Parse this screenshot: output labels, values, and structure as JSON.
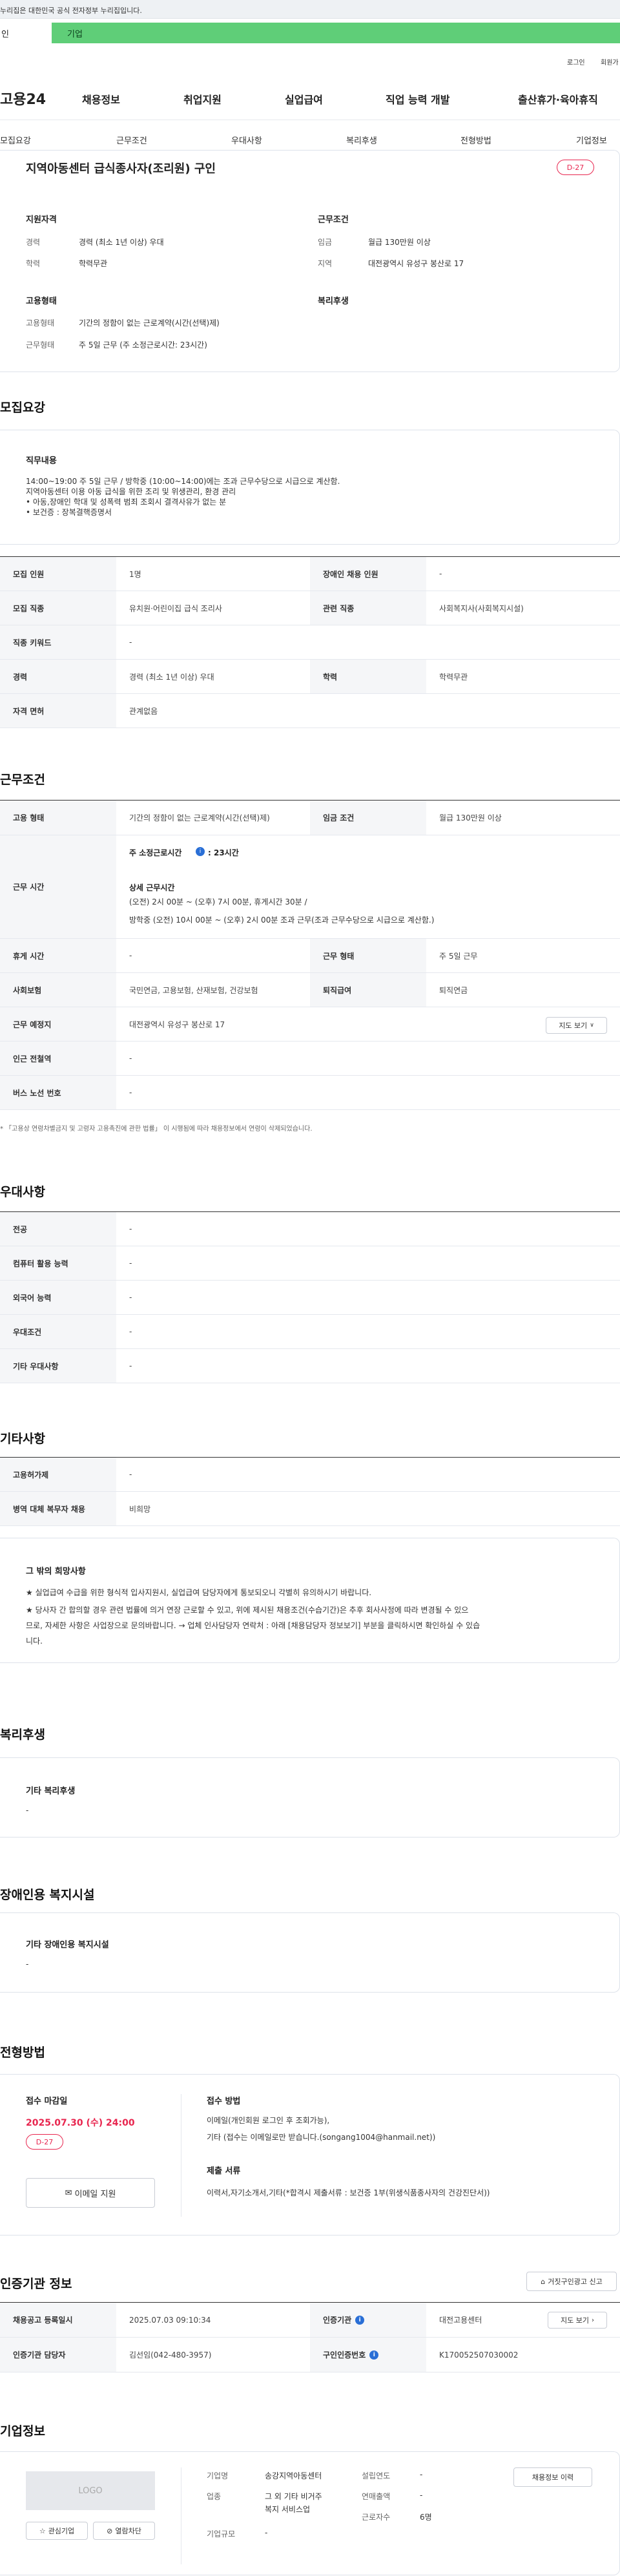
{
  "gov_banner": "누리집은 대한민국 공식 전자정부 누리집입니다.",
  "usertabs": {
    "person": "인",
    "company": "기업"
  },
  "util": {
    "login": "로그인",
    "join": "회원가"
  },
  "gnb": {
    "logo": "고용24",
    "items": [
      "채용정보",
      "취업지원",
      "실업급여",
      "직업 능력 개발",
      "출산휴가·육아휴직"
    ]
  },
  "tabs": [
    "모집요강",
    "근무조건",
    "우대사항",
    "복리후생",
    "전형방법",
    "기업정보"
  ],
  "summary": {
    "title": "지역아동센터 급식종사자(조리원) 구인",
    "dday": "D-27",
    "qual_head": "지원자격",
    "qual": [
      {
        "k": "경력",
        "v": "경력 (최소 1년 이상) 우대"
      },
      {
        "k": "학력",
        "v": "학력무관"
      }
    ],
    "cond_head": "근무조건",
    "cond": [
      {
        "k": "임금",
        "v": "월급 130만원 이상"
      },
      {
        "k": "지역",
        "v": "대전광역시 유성구 봉산로 17"
      }
    ],
    "emp_head": "고용형태",
    "emp": [
      {
        "k": "고용형태",
        "v": "기간의 정함이 없는 근로계약(시간(선택)제)"
      },
      {
        "k": "근무형태",
        "v": "주 5일 근무 (주 소정근로시간: 23시간)"
      }
    ],
    "welfare_head": "복리후생"
  },
  "recruit": {
    "title": "모집요강",
    "duty_head": "직무내용",
    "duty_lines": [
      "14:00~19:00 주 5일 근무 / 방학중 (10:00~14:00)에는 조과 근무수당으로 시급으로 계산함.",
      "지역아동센터 이용 아동 급식을 위한 조리 및 위생관리, 환경 관리",
      "• 아동,장애인 학대 및 성폭력 범죄 조회시 결격사유가 없는 분",
      "• 보건증 : 장복결핵증명서"
    ],
    "rows": [
      {
        "k1": "모집 인원",
        "v1": "1명",
        "k2": "장애인 채용 인원",
        "v2": "-"
      },
      {
        "k1": "모집 직종",
        "v1": "유치원·어린이집 급식 조리사",
        "k2": "관련 직종",
        "v2": "사회복지사(사회복지시설)"
      },
      {
        "k1": "직종 키워드",
        "v1": "-"
      },
      {
        "k1": "경력",
        "v1": "경력 (최소 1년 이상) 우대",
        "k2": "학력",
        "v2": "학력무관"
      },
      {
        "k1": "자격 면허",
        "v1": "관계없음"
      }
    ]
  },
  "work": {
    "title": "근무조건",
    "r1": {
      "k1": "고용 형태",
      "v1": "기간의 정함이 없는 근로계약(시간(선택)제)",
      "k2": "임금 조건",
      "v2": "월급 130만원 이상"
    },
    "hours": {
      "k": "근무 시간",
      "weekly_label": "주 소정근로시간",
      "weekly_value": ": 23시간",
      "detail_head": "상세 근무시간",
      "lines": [
        "(오전) 2시 00분 ~ (오후) 7시 00분, 휴게시간 30분 /",
        "방학중 (오전) 10시 00분 ~ (오후) 2시 00분 조과 근무(조과 근무수당으로 시급으로 계산함.)"
      ]
    },
    "r2": {
      "k1": "휴게 시간",
      "v1": "-",
      "k2": "근무 형태",
      "v2": "주 5일 근무"
    },
    "r3": {
      "k1": "사회보험",
      "v1": "국민연금, 고용보험, 산재보험, 건강보험",
      "k2": "퇴직급여",
      "v2": "퇴직연금"
    },
    "r4": {
      "k": "근무 예정지",
      "v": "대전광역시 유성구 봉산로 17",
      "btn": "지도 보기"
    },
    "r5": {
      "k": "인근 전철역",
      "v": "-"
    },
    "r6": {
      "k": "버스 노선 번호",
      "v": "-"
    },
    "note": "* 「고용상 연령차별금지 및 고령자 고용촉진에 관한 법률」 이 시행됨에 따라 채용정보에서 연령이 삭제되었습니다."
  },
  "pref": {
    "title": "우대사항",
    "rows": [
      {
        "k": "전공",
        "v": "-"
      },
      {
        "k": "컴퓨터 활용 능력",
        "v": "-"
      },
      {
        "k": "외국어 능력",
        "v": "-"
      },
      {
        "k": "우대조건",
        "v": "-"
      },
      {
        "k": "기타 우대사항",
        "v": "-"
      }
    ]
  },
  "etc": {
    "title": "기타사항",
    "rows": [
      {
        "k": "고용허가제",
        "v": "-"
      },
      {
        "k": "병역 대체 복무자 채용",
        "v": "비희망"
      }
    ],
    "hope_head": "그 밖의 희망사항",
    "hope_lines": [
      "★ 실업급여 수급을 위한 형식적 입사지원시, 실업급여 담당자에게 통보되오니 각별히 유의하시기 바랍니다.",
      "★ 당사자 간 합의할 경우 관련 법률에 의거 연장 근로할 수 있고, 위에 제시된 채용조건(수습기간)은 추후 회사사정에 따라 변경될 수 있으",
      "므로, 자세한 사항은 사업장으로 문의바랍니다. → 업체 인사담당자 연락처 : 아래 [채용담당자 정보보기] 부분을 클릭하시면 확인하실 수 있습",
      "니다."
    ]
  },
  "welfare": {
    "title": "복리후생",
    "head": "기타 복리후생",
    "value": "-"
  },
  "disab": {
    "title": "장애인용 복지시설",
    "head": "기타 장애인용 복지시설",
    "value": "-"
  },
  "process": {
    "title": "전형방법",
    "deadline_head": "접수 마감일",
    "deadline": "2025.07.30 (수) 24:00",
    "dday": "D-27",
    "email_btn": "이메일 지원",
    "method_head": "접수 방법",
    "method_lines": [
      "이메일(개인회원 로그인 후 조회가능),",
      "기타 (접수는 이메일로만 받습니다.(songang1004@hanmail.net))"
    ],
    "docs_head": "제출 서류",
    "docs": "이력서,자기소개서,기타(*합격시 제출서류 : 보건증 1부(위생식품종사자의 건강진단서))"
  },
  "cert": {
    "title": "인증기관 정보",
    "report_btn": "거짓구인광고 신고",
    "r1": {
      "k1": "채용공고 등록일시",
      "v1": "2025.07.03 09:10:34",
      "k2": "인증기관",
      "v2": "대전고용센터",
      "btn": "지도 보기"
    },
    "r2": {
      "k1": "인증기관 담당자",
      "v1": "김선임(042-480-3957)",
      "k2": "구인인증번호",
      "v2": "K170052507030002"
    }
  },
  "company": {
    "title": "기업정보",
    "logo": "LOGO",
    "fav_btn": "관심기업",
    "block_btn": "열람차단",
    "info_btn": "채용정보 이력",
    "f": [
      {
        "k": "기업명",
        "v": "송강지역아동센터"
      },
      {
        "k": "업종",
        "v1": "그 외 기타 비거주",
        "v2": "복지 서비스업"
      },
      {
        "k": "기업규모",
        "v": "-"
      },
      {
        "k": "설립연도",
        "v": "-"
      },
      {
        "k": "연매출액",
        "v": "-"
      },
      {
        "k": "근로자수",
        "v": "6명"
      }
    ]
  },
  "colors": {
    "accent": "#e8264f",
    "green": "#5fce78",
    "link": "#2a6fd6"
  }
}
